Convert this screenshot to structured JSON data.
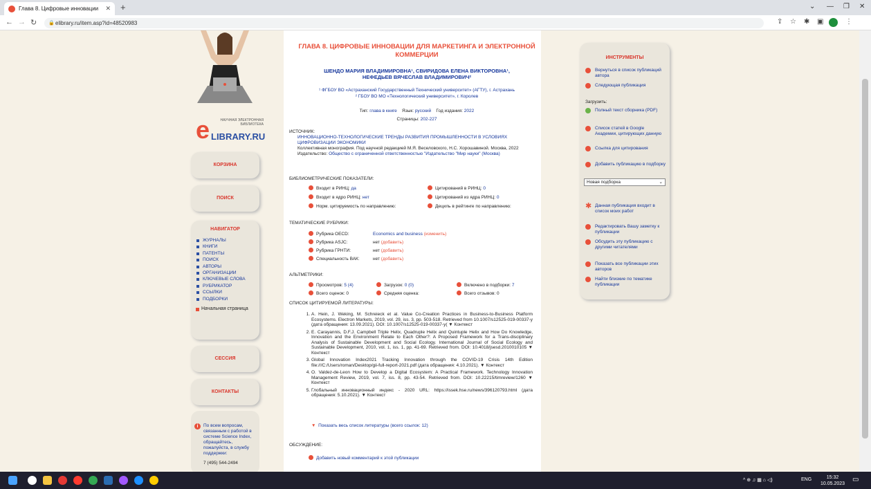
{
  "browser": {
    "tab_title": "Глава 8. Цифровые инновации",
    "url": "elibrary.ru/item.asp?id=48520983"
  },
  "logo": {
    "small": "НАУЧНАЯ ЭЛЕКТРОННАЯ БИБЛИОТЕКА",
    "name": "LIBRARY.RU",
    "e": "e"
  },
  "sidebar": {
    "cart": "КОРЗИНА",
    "search": "ПОИСК",
    "navigator": "НАВИГАТОР",
    "nav_items": [
      "ЖУРНАЛЫ",
      "КНИГИ",
      "ПАТЕНТЫ",
      "ПОИСК",
      "АВТОРЫ",
      "ОРГАНИЗАЦИИ",
      "КЛЮЧЕВЫЕ СЛОВА",
      "РУБРИКАТОР",
      "ССЫЛКИ",
      "ПОДБОРКИ"
    ],
    "home": "Начальная страница",
    "session": "СЕССИЯ",
    "contacts": "КОНТАКТЫ",
    "support": "По всем вопросам, связанным с работой в системе Science Index, обращайтесь, пожалуйста, в службу поддержки:",
    "phone": "7 (495) 544-2494"
  },
  "article": {
    "title": "ГЛАВА 8. ЦИФРОВЫЕ ИННОВАЦИИ ДЛЯ МАРКЕТИНГА И ЭЛЕКТРОННОЙ КОММЕРЦИИ",
    "authors": "ШЕНДО МАРИЯ ВЛАДИМИРОВНА¹, СВИРИДОВА ЕЛЕНА ВИКТОРОВНА¹, НЕФЕДЬЕВ ВЯЧЕСЛАВ ВЛАДИМИРОВИЧ²",
    "aff1": "¹ ФГБОУ ВО «Астраханский Государственный Технический университет» (АГТУ), г. Астрахань",
    "aff2": "² ГБОУ ВО МО «Технологический университет», г. Королев",
    "type_k": "Тип:",
    "type_v": "глава в книге",
    "lang_k": "Язык:",
    "lang_v": "русский",
    "year_k": "Год издания:",
    "year_v": "2022",
    "pages_k": "Страницы:",
    "pages_v": "202-227"
  },
  "source": {
    "label": "ИСТОЧНИК:",
    "title": "ИННОВАЦИОННО-ТЕХНОЛОГИЧЕСКИЕ ТРЕНДЫ РАЗВИТИЯ ПРОМЫШЛЕННОСТИ В УСЛОВИЯХ ЦИФРОВИЗАЦИИ ЭКОНОМИКИ",
    "desc": "Коллективная монография. Под научной редакцией М.Я. Веселовского, Н.С. Хорошавиной. Москва, 2022",
    "pub_k": "Издательство:",
    "pub_v": "Общество с ограниченной ответственностью \"Издательство \"Мир науки\" (Москва)"
  },
  "biblio": {
    "label": "БИБЛИОМЕТРИЧЕСКИЕ ПОКАЗАТЕЛИ:",
    "rinc_k": "Входит в РИНЦ:",
    "rinc_v": "да",
    "core_k": "Входит в ядро РИНЦ:",
    "core_v": "нет",
    "norm": "Норм. цитируемость по направлению:",
    "cit_k": "Цитирований в РИНЦ:",
    "cit_v": "0",
    "cit_core_k": "Цитирований из ядра РИНЦ:",
    "cit_core_v": "0",
    "decile": "Дециль в рейтинге по направлению:"
  },
  "rubrics": {
    "label": "ТЕМАТИЧЕСКИЕ РУБРИКИ:",
    "oecd_k": "Рубрика OECD:",
    "oecd_v": "Economics and business",
    "change": "(изменить)",
    "asjc_k": "Рубрика ASJC:",
    "grnti_k": "Рубрика ГРНТИ:",
    "vak_k": "Специальность ВАК:",
    "none": "нет",
    "add": "(добавить)"
  },
  "altm": {
    "label": "АЛЬТМЕТРИКИ:",
    "views_k": "Просмотров:",
    "views_v": "5 (4)",
    "downloads_k": "Загрузок:",
    "downloads_v": "0 (0)",
    "incl_k": "Включено в подборки:",
    "incl_v": "7",
    "ratings_k": "Всего оценок:",
    "ratings_v": "0",
    "avg_k": "Средняя оценка:",
    "reviews_k": "Всего отзывов:",
    "reviews_v": "0"
  },
  "refs": {
    "label": "СПИСОК ЦИТИРУЕМОЙ ЛИТЕРАТУРЫ:",
    "items": [
      "A. Hein, J. Weking, M. Schreieck et al. Value Co-Creation Practices in Business-to-Business Platform Ecosystems. Electron Markets, 2019, vol. 29, iss. 3, pp. 503-518. Retrieved from 10.1007/s12525-019-00337-y (дата обращения: 13.09.2021). DOI: 10.1007/s12525-019-00337-y( ▼ Контекст",
      "E. Carayannis, D.F.J. Campbell Triple Helix, Quadruple Helix and Quintuple Helix and How Do Knowledge, Innovation and the Environment Relate to Each Other?: A Proposed Framework for a Trans-disciplinary Analysis of Sustainable Development and Social Ecology. International Journal of Social Ecology and Sustainable Development, 2010, vol. 1, iss. 1, pp. 41-69. Retrieved from. DOI: 10.4018/jsesd.2010010105 ▼ Контекст",
      "Global Innovation Index2021 Tracking Innovation through the COVID-19 Crisis 14th Edition file:///C:/Users/roman/Desktop/gii-full-report-2021.pdf (дата обращения: 4.10.2021). ▼ Контекст",
      "O. Valdez-de-Leon How to Develop a Digital Ecosystem: A Practical Framework. Technology Innovation Management Review, 2019, vol. 7, iss. 8, pp. 43-54. Retrieved from. DOI: 10.22215/timreview/1260 ▼ Контекст",
      "Глобальный инновационный индекс - 2020 URL: https://issek.hse.ru/news/396120793.html (дата обращения: 5.10.2021). ▼ Контекст"
    ],
    "show_all": "Показать весь список литературы (всего ссылок: 12)"
  },
  "discussion": {
    "label": "ОБСУЖДЕНИЕ:",
    "add": "Добавить новый комментарий к этой публикации"
  },
  "tools": {
    "title": "ИНСТРУМЕНТЫ",
    "back": "Вернуться в список публикаций автора",
    "next": "Следующая публикация",
    "download_label": "Загрузить:",
    "fulltext": "Полный текст сборника (PDF)",
    "google": "Список статей в Google Академии, цитирующих данную",
    "cite": "Ссылка для цитирования",
    "add_sel": "Добавить публикацию в подборку",
    "select": "Новая подборка",
    "mywork": "Данная публикация входит в список моих работ",
    "edit_note": "Редактировать Вашу заметку к публикации",
    "discuss": "Обсудить эту публикацию с другими читателями",
    "show_all": "Показать все публикации этих авторов",
    "similar": "Найти близкие по тематике публикации"
  },
  "taskbar": {
    "lang": "ENG",
    "time": "15:32",
    "date": "10.05.2023"
  }
}
